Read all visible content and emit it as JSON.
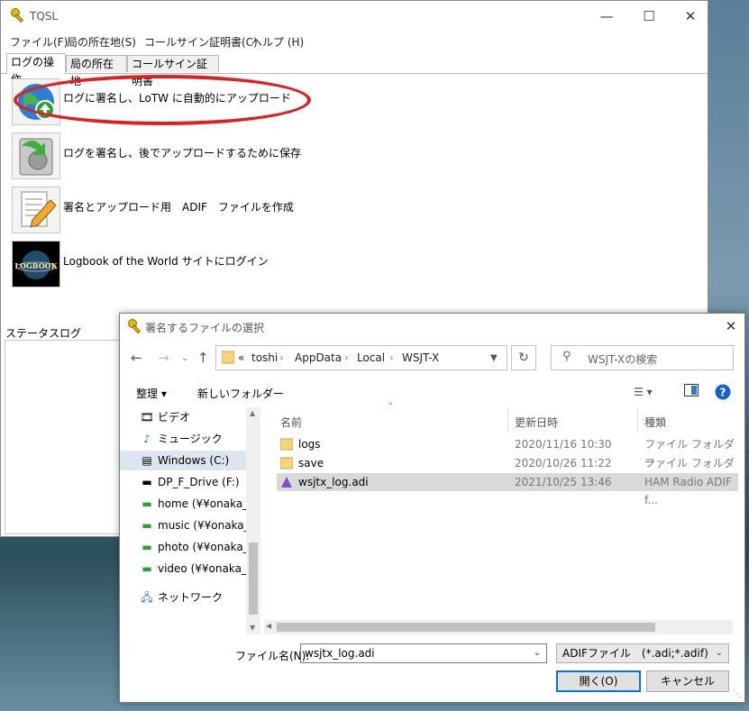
{
  "main_window": {
    "title": "TQSL",
    "menu": [
      "ファイル(F)",
      "局の所在地(S)",
      "コールサイン証明書(C)",
      "ヘルプ (H)"
    ],
    "tabs": [
      "ログの操作",
      "局の所在地",
      "コールサイン証明書"
    ],
    "actions": [
      "ログに署名し、LoTW に自動的にアップロード",
      "ログを署名し、後でアップロードするために保存",
      "署名とアップロード用　ADIF　ファイルを作成",
      "Logbook of the World サイトにログイン"
    ],
    "status_label": "ステータスログ",
    "logo_text": "LOGBOOK"
  },
  "dialog": {
    "title": "署名するファイルの選択",
    "path": [
      "«",
      "toshi",
      "AppData",
      "Local",
      "WSJT-X"
    ],
    "search_placeholder": "WSJT-Xの検索",
    "organize_label": "整理 ▾",
    "new_folder_label": "新しいフォルダー",
    "nav_items": [
      {
        "icon": "video-icon",
        "label": "ビデオ"
      },
      {
        "icon": "music-icon",
        "label": "ミュージック"
      },
      {
        "icon": "drive-icon",
        "label": "Windows (C:)"
      },
      {
        "icon": "drive-icon",
        "label": "DP_F_Drive (F:)"
      },
      {
        "icon": "network-drive-icon",
        "label": "home (¥¥onaka_"
      },
      {
        "icon": "network-drive-icon",
        "label": "music (¥¥onaka_"
      },
      {
        "icon": "network-drive-icon",
        "label": "photo (¥¥onaka_"
      },
      {
        "icon": "network-drive-icon",
        "label": "video (¥¥onaka_"
      },
      {
        "icon": "network-icon",
        "label": "ネットワーク"
      }
    ],
    "columns": [
      "名前",
      "更新日時",
      "種類"
    ],
    "files": [
      {
        "name": "logs",
        "date": "2020/11/16 10:30",
        "type": "ファイル フォルダー",
        "icon": "folder-icon"
      },
      {
        "name": "save",
        "date": "2020/10/26 11:22",
        "type": "ファイル フォルダー",
        "icon": "folder-icon"
      },
      {
        "name": "wsjtx_log.adi",
        "date": "2021/10/25 13:46",
        "type": "HAM Radio ADIF f...",
        "icon": "adif-file-icon"
      }
    ],
    "filename_label": "ファイル名(N):",
    "filename_value": "wsjtx_log.adi",
    "filter_value": "ADIFファイル　(*.adi;*.adif)",
    "open_label": "開く(O)",
    "cancel_label": "キャンセル"
  },
  "colors": {
    "annotation_circle": "#e02020",
    "accent": "#0078d7"
  }
}
